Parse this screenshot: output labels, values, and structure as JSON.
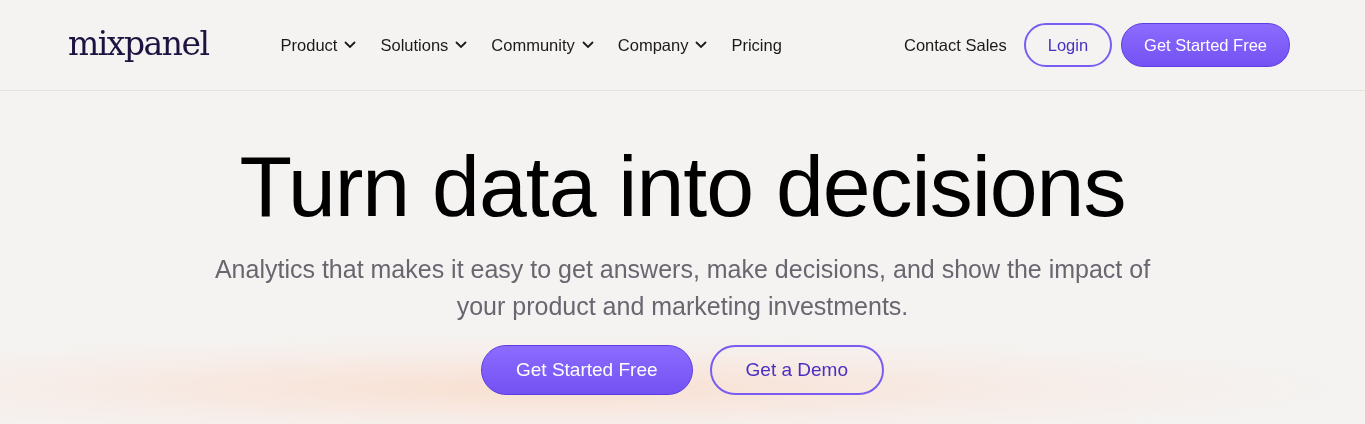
{
  "logo": "mixpanel",
  "nav": [
    {
      "label": "Product",
      "dropdown": true
    },
    {
      "label": "Solutions",
      "dropdown": true
    },
    {
      "label": "Community",
      "dropdown": true
    },
    {
      "label": "Company",
      "dropdown": true
    },
    {
      "label": "Pricing",
      "dropdown": false
    }
  ],
  "header_actions": [
    {
      "label": "Contact Sales",
      "kind": "link"
    },
    {
      "label": "Login",
      "kind": "outline"
    },
    {
      "label": "Get Started Free",
      "kind": "primary"
    }
  ],
  "hero": {
    "title": "Turn data into decisions",
    "subtitle": "Analytics that makes it easy to get answers, make decisions, and show the impact of your product and marketing investments.",
    "buttons": [
      {
        "label": "Get Started Free",
        "kind": "primary"
      },
      {
        "label": "Get a Demo",
        "kind": "outline"
      }
    ]
  }
}
